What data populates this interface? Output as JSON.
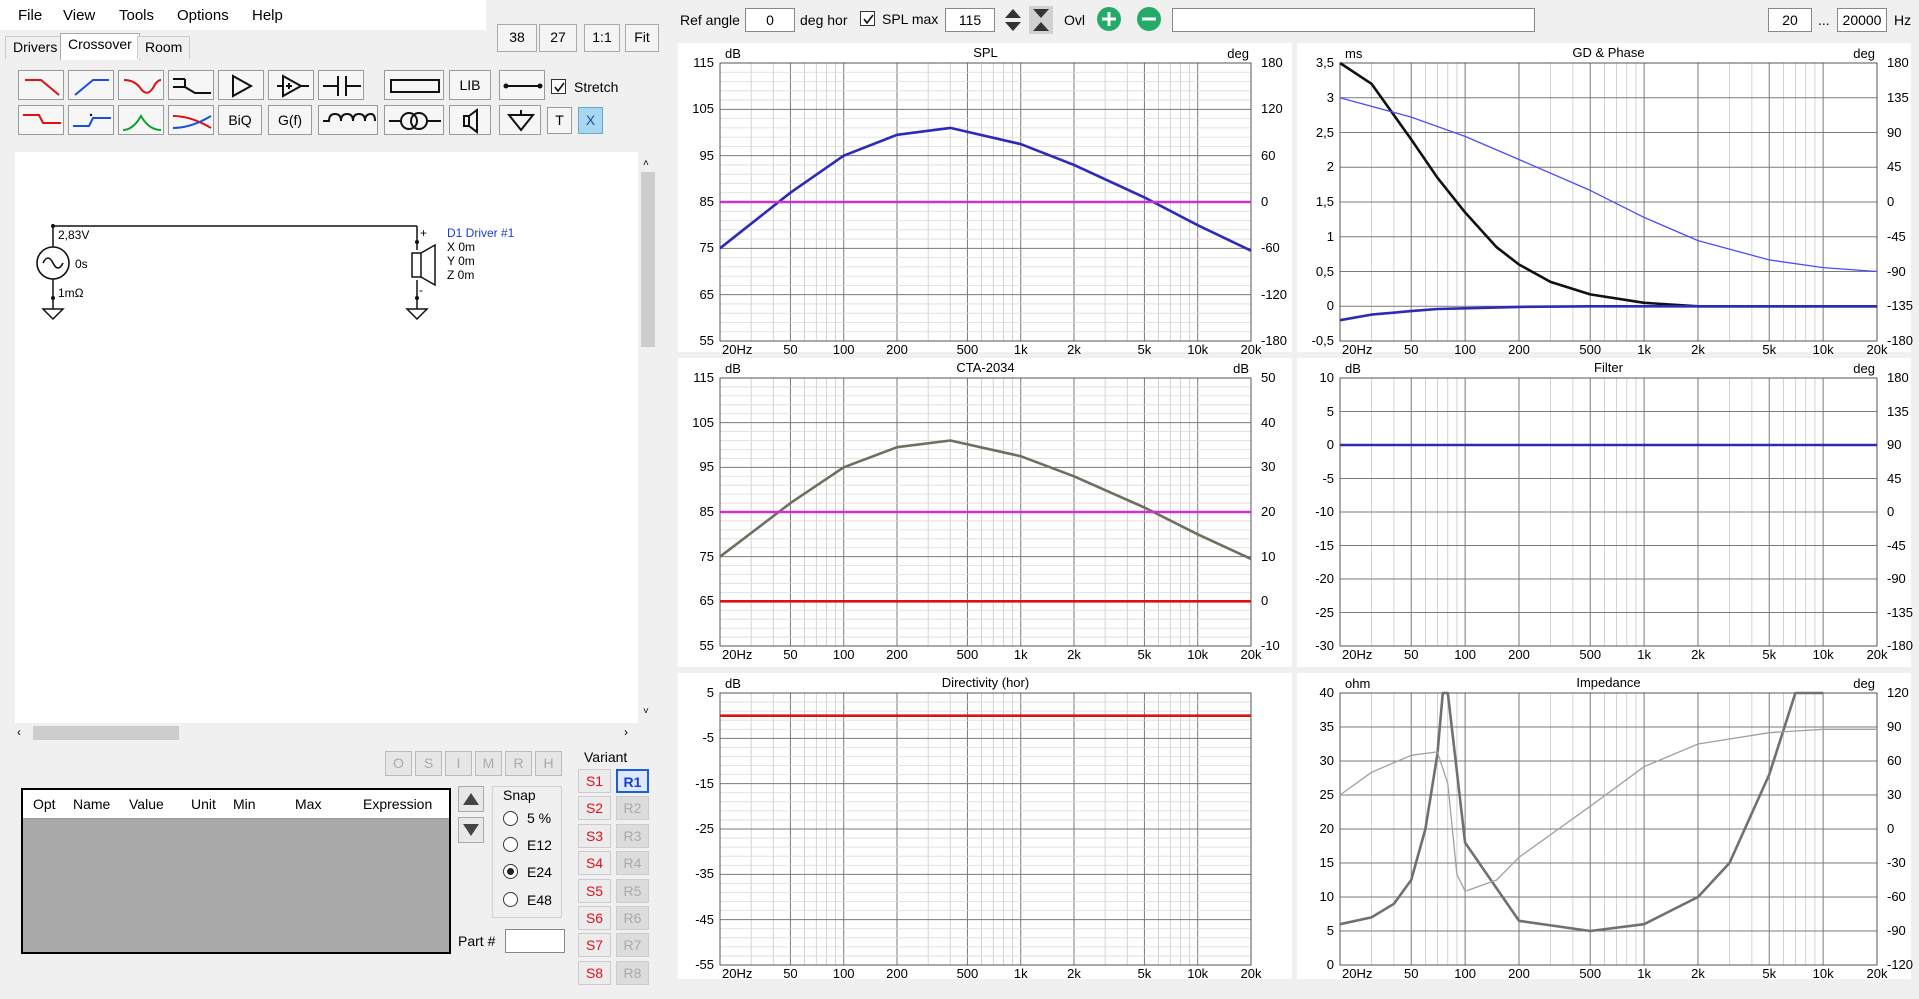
{
  "menu": {
    "items": [
      "File",
      "View",
      "Tools",
      "Options",
      "Help"
    ]
  },
  "tabs": [
    "Drivers",
    "Crossover",
    "Room"
  ],
  "zoom_buttons": [
    "38",
    "27",
    "1:1",
    "Fit"
  ],
  "palette": {
    "row2_labels": {
      "biq": "BiQ",
      "gf": "G(f)"
    },
    "lib_label": "LIB",
    "stretch_label": "Stretch",
    "t_label": "T",
    "x_label": "X",
    "icons": [
      "lowpass-icon",
      "highpass-icon",
      "bandstop-icon",
      "shelf-icon",
      "amplifier-icon",
      "buffer-icon",
      "capacitor-icon",
      "resistor-icon",
      "lib-icon",
      "wire-icon",
      "lowpass-alt-icon",
      "highpass-alt-icon",
      "bandpass-icon",
      "allpass-icon",
      "biq-icon",
      "gf-icon",
      "inductor-icon",
      "transformer-icon",
      "speaker-icon",
      "ground-icon"
    ]
  },
  "schematic": {
    "voltage": "2,83V",
    "delay": "0s",
    "resistance": "1mΩ",
    "driver_name": "D1 Driver #1",
    "x": "X 0m",
    "y": "Y 0m",
    "z": "Z 0m"
  },
  "part_table": {
    "headers": [
      "Opt",
      "Name",
      "Value",
      "Unit",
      "Min",
      "Max",
      "Expression"
    ]
  },
  "opt_buttons": [
    "O",
    "S",
    "I",
    "M",
    "R",
    "H"
  ],
  "snap": {
    "title": "Snap",
    "options": [
      "5 %",
      "E12",
      "E24",
      "E48"
    ],
    "selected": "E24"
  },
  "part_num_label": "Part #",
  "variant": {
    "title": "Variant",
    "s": [
      "S1",
      "S2",
      "S3",
      "S4",
      "S5",
      "S6",
      "S7",
      "S8"
    ],
    "r": [
      "R1",
      "R2",
      "R3",
      "R4",
      "R5",
      "R6",
      "R7",
      "R8"
    ],
    "active": "R1"
  },
  "toolbar": {
    "ref_angle_label": "Ref angle",
    "ref_angle_value": "0",
    "deg_hor_label": "deg hor",
    "spl_max_label": "SPL max",
    "spl_max_value": "115",
    "ovl_label": "Ovl",
    "freq_min": "20",
    "freq_sep": "...",
    "freq_max": "20000",
    "hz_label": "Hz"
  },
  "freq_ticks": [
    "20Hz",
    "50",
    "100",
    "200",
    "500",
    "1k",
    "2k",
    "5k",
    "10k",
    "20k"
  ],
  "charts": [
    {
      "title": "SPL",
      "left_unit": "dB",
      "right_unit": "deg",
      "left_ticks": [
        "115",
        "105",
        "95",
        "85",
        "75",
        "65",
        "55"
      ],
      "right_ticks": [
        "180",
        "120",
        "60",
        "0",
        "-60",
        "-120",
        "-180"
      ]
    },
    {
      "title": "GD & Phase",
      "left_unit": "ms",
      "right_unit": "deg",
      "left_ticks": [
        "3,5",
        "3",
        "2,5",
        "2",
        "1,5",
        "1",
        "0,5",
        "0",
        "-0,5"
      ],
      "right_ticks": [
        "180",
        "135",
        "90",
        "45",
        "0",
        "-45",
        "-90",
        "-135",
        "-180"
      ]
    },
    {
      "title": "CTA-2034",
      "left_unit": "dB",
      "right_unit": "dB",
      "left_ticks": [
        "115",
        "105",
        "95",
        "85",
        "75",
        "65",
        "55"
      ],
      "right_ticks": [
        "50",
        "40",
        "30",
        "20",
        "10",
        "0",
        "-10"
      ]
    },
    {
      "title": "Filter",
      "left_unit": "dB",
      "right_unit": "deg",
      "left_ticks": [
        "10",
        "5",
        "0",
        "-5",
        "-10",
        "-15",
        "-20",
        "-25",
        "-30"
      ],
      "right_ticks": [
        "180",
        "135",
        "90",
        "45",
        "0",
        "-45",
        "-90",
        "-135",
        "-180"
      ]
    },
    {
      "title": "Directivity (hor)",
      "left_unit": "dB",
      "right_unit": "",
      "left_ticks": [
        "5",
        "-5",
        "-15",
        "-25",
        "-35",
        "-45",
        "-55"
      ],
      "right_ticks": []
    },
    {
      "title": "Impedance",
      "left_unit": "ohm",
      "right_unit": "deg",
      "left_ticks": [
        "40",
        "35",
        "30",
        "25",
        "20",
        "15",
        "10",
        "5",
        "0"
      ],
      "right_ticks": [
        "120",
        "90",
        "60",
        "30",
        "0",
        "-30",
        "-60",
        "-90",
        "-120"
      ]
    }
  ],
  "chart_data": [
    {
      "type": "line",
      "title": "SPL",
      "xlabel": "",
      "ylabel": "dB",
      "y2label": "deg",
      "xscale": "log",
      "xlim": [
        20,
        20000
      ],
      "ylim": [
        55,
        115
      ],
      "y2lim": [
        -180,
        180
      ],
      "grid": true,
      "series": [
        {
          "color": "#2b2bb8",
          "axis": "left",
          "x": [
            20,
            50,
            100,
            200,
            400,
            1000,
            2000,
            5000,
            10000,
            20000
          ],
          "y": [
            75,
            87,
            95,
            99.5,
            101,
            97.5,
            93,
            86,
            80,
            74.5
          ]
        },
        {
          "color": "#cc33cc",
          "axis": "left",
          "x": [
            20,
            20000
          ],
          "y": [
            85,
            85
          ]
        }
      ]
    },
    {
      "type": "line",
      "title": "GD & Phase",
      "xlabel": "",
      "ylabel": "ms",
      "y2label": "deg",
      "xscale": "log",
      "xlim": [
        20,
        20000
      ],
      "ylim": [
        -0.5,
        3.5
      ],
      "y2lim": [
        -180,
        180
      ],
      "grid": true,
      "series": [
        {
          "color": "#111111",
          "axis": "left",
          "x": [
            20,
            30,
            50,
            70,
            100,
            150,
            200,
            300,
            500,
            1000,
            2000,
            5000,
            20000
          ],
          "y": [
            3.5,
            3.2,
            2.4,
            1.85,
            1.35,
            0.85,
            0.6,
            0.35,
            0.17,
            0.05,
            0.0,
            0.0,
            0.0
          ]
        },
        {
          "color": "#4b4bff",
          "axis": "right",
          "x": [
            20,
            50,
            100,
            200,
            500,
            1000,
            2000,
            5000,
            10000,
            20000
          ],
          "y": [
            135,
            110,
            85,
            55,
            15,
            -20,
            -50,
            -75,
            -85,
            -90
          ]
        },
        {
          "color": "#2b2bb8",
          "axis": "left",
          "x": [
            20,
            30,
            50,
            70,
            100,
            200,
            500,
            1000,
            20000
          ],
          "y": [
            -0.2,
            -0.12,
            -0.07,
            -0.04,
            -0.03,
            -0.01,
            0.0,
            0.0,
            0.0
          ]
        }
      ]
    },
    {
      "type": "line",
      "title": "CTA-2034",
      "xlabel": "",
      "ylabel": "dB",
      "y2label": "dB",
      "xscale": "log",
      "xlim": [
        20,
        20000
      ],
      "ylim": [
        55,
        115
      ],
      "y2lim": [
        -10,
        50
      ],
      "grid": true,
      "series": [
        {
          "color": "#6f6f5f",
          "axis": "left",
          "x": [
            20,
            50,
            100,
            200,
            400,
            1000,
            2000,
            5000,
            10000,
            20000
          ],
          "y": [
            75,
            87,
            95,
            99.5,
            101,
            97.5,
            93,
            86,
            80,
            74.5
          ]
        },
        {
          "color": "#cc33cc",
          "axis": "left",
          "x": [
            20,
            20000
          ],
          "y": [
            85,
            85
          ]
        },
        {
          "color": "#e01010",
          "axis": "left",
          "x": [
            20,
            20000
          ],
          "y": [
            65,
            65
          ]
        }
      ]
    },
    {
      "type": "line",
      "title": "Filter",
      "xlabel": "",
      "ylabel": "dB",
      "y2label": "deg",
      "xscale": "log",
      "xlim": [
        20,
        20000
      ],
      "ylim": [
        -30,
        10
      ],
      "y2lim": [
        -180,
        180
      ],
      "grid": true,
      "series": [
        {
          "color": "#2b2bb8",
          "axis": "left",
          "x": [
            20,
            20000
          ],
          "y": [
            0,
            0
          ]
        }
      ]
    },
    {
      "type": "line",
      "title": "Directivity (hor)",
      "xlabel": "",
      "ylabel": "dB",
      "xscale": "log",
      "xlim": [
        20,
        20000
      ],
      "ylim": [
        -55,
        5
      ],
      "grid": true,
      "series": [
        {
          "color": "#e01010",
          "axis": "left",
          "x": [
            20,
            20000
          ],
          "y": [
            0,
            0
          ]
        }
      ]
    },
    {
      "type": "line",
      "title": "Impedance",
      "xlabel": "",
      "ylabel": "ohm",
      "y2label": "deg",
      "xscale": "log",
      "xlim": [
        20,
        20000
      ],
      "ylim": [
        0,
        40
      ],
      "y2lim": [
        -120,
        120
      ],
      "grid": true,
      "series": [
        {
          "color": "#707070",
          "axis": "left",
          "x": [
            20,
            30,
            40,
            50,
            60,
            70,
            75,
            80,
            100,
            200,
            500,
            1000,
            2000,
            3000,
            5000,
            7000,
            10000
          ],
          "y": [
            6,
            7,
            9,
            12.5,
            20,
            31,
            40,
            40,
            18,
            6.5,
            5,
            6,
            10,
            15,
            28,
            40,
            40
          ]
        },
        {
          "color": "#a0a0a0",
          "axis": "right",
          "x": [
            20,
            30,
            50,
            70,
            80,
            90,
            100,
            150,
            200,
            500,
            1000,
            2000,
            5000,
            10000,
            20000
          ],
          "y": [
            30,
            50,
            65,
            68,
            40,
            -40,
            -55,
            -45,
            -25,
            20,
            55,
            75,
            85,
            88,
            88
          ]
        }
      ]
    }
  ]
}
